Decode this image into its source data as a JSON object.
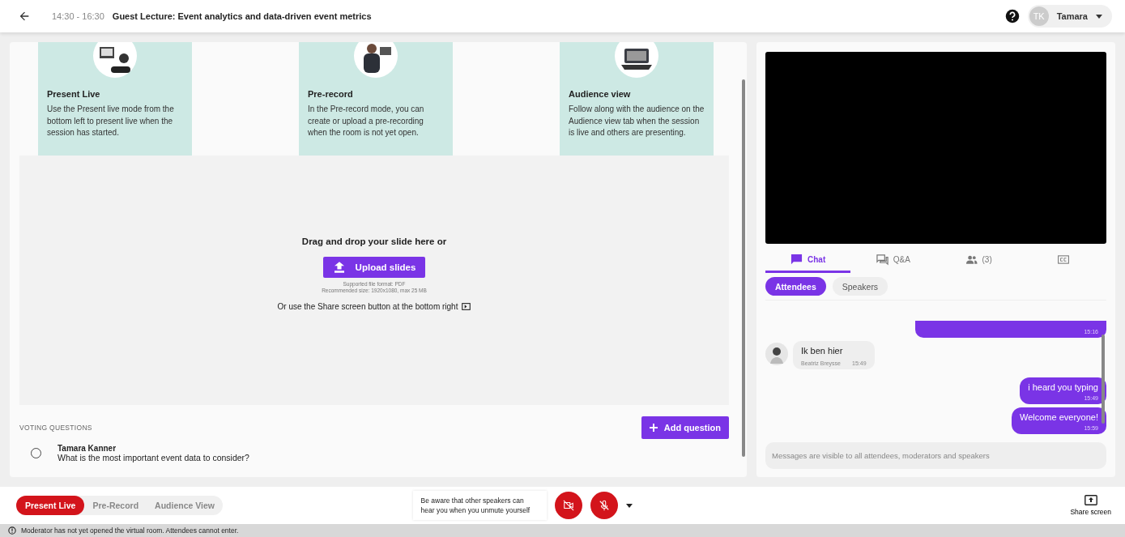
{
  "header": {
    "time": "14:30 - 16:30",
    "title": "Guest Lecture: Event analytics and data-driven event metrics",
    "user_initials": "TK",
    "user_name": "Tamara"
  },
  "mode_cards": [
    {
      "title": "Present Live",
      "text": "Use the Present live mode from the bottom left to present live when the session has started."
    },
    {
      "title": "Pre-record",
      "text": "In the Pre-record mode, you can create or upload a pre-recording when the room is not yet open."
    },
    {
      "title": "Audience view",
      "text": "Follow along with the audience on the Audience view tab when the session is live and others are presenting."
    }
  ],
  "upload": {
    "heading": "Drag and drop your slide here or",
    "button": "Upload slides",
    "format_note": "Supported file format: PDF",
    "size_note": "Recommended size: 1920x1080, max 25 MB",
    "share_hint": "Or use the Share screen button at the bottom right"
  },
  "voting": {
    "heading": "VOTING QUESTIONS",
    "add_button": "Add question",
    "questions": [
      {
        "author": "Tamara Kanner",
        "text": "What is the most important event data to consider?",
        "selected": false
      }
    ]
  },
  "chat_tabs": [
    {
      "kind": "chat",
      "label": "Chat",
      "selected": true
    },
    {
      "kind": "qa",
      "label": "Q&A",
      "selected": false
    },
    {
      "kind": "people",
      "label": "(3)",
      "selected": false
    },
    {
      "kind": "captions",
      "selected": false
    }
  ],
  "audience_pills": [
    {
      "label": "Attendees",
      "selected": true
    },
    {
      "label": "Speakers",
      "selected": false
    }
  ],
  "messages": [
    {
      "kind": "mine",
      "time": "15:16"
    },
    {
      "kind": "other",
      "text": "Ik ben hier",
      "author": "Beatriz Breysse",
      "time": "15:49"
    },
    {
      "kind": "mine",
      "text": "i heard you typing",
      "time": "15:49"
    },
    {
      "kind": "mine",
      "text": "Welcome everyone!",
      "time": "15:59"
    }
  ],
  "chat_input": {
    "placeholder": "Messages are visible to all attendees, moderators and speakers"
  },
  "modes": [
    {
      "label": "Present Live",
      "selected": true
    },
    {
      "label": "Pre-Record",
      "selected": false
    },
    {
      "label": "Audience View",
      "selected": false
    }
  ],
  "notice": "Be aware that other speakers can hear you when you unmute yourself",
  "camera": {
    "on": false
  },
  "microphone": {
    "on": false
  },
  "share_screen": "Share screen",
  "status_bar": "Moderator has not yet opened the virtual room. Attendees cannot enter."
}
